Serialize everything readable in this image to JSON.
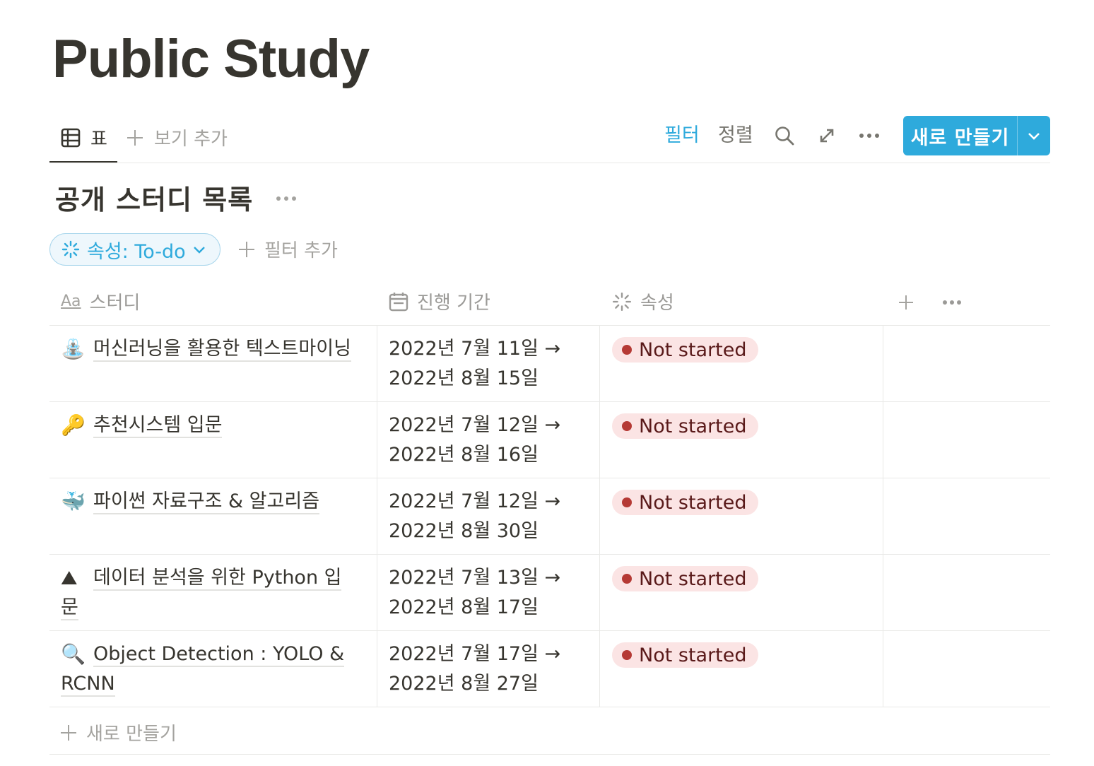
{
  "page": {
    "title": "Public Study"
  },
  "views": {
    "tabs": [
      {
        "label": "표",
        "icon": "table-icon",
        "active": true
      }
    ],
    "add_view_label": "보기 추가"
  },
  "toolbar": {
    "filter_label": "필터",
    "sort_label": "정렬",
    "new_button_label": "새로 만들기",
    "accent_color": "#2eaadc"
  },
  "database": {
    "title": "공개 스터디 목록",
    "filter_chip": {
      "label": "속성: To-do"
    },
    "add_filter_label": "필터 추가",
    "columns": [
      {
        "label": "스터디",
        "icon": "text-icon",
        "icon_text": "Aa"
      },
      {
        "label": "진행 기간",
        "icon": "calendar-icon"
      },
      {
        "label": "속성",
        "icon": "status-icon"
      }
    ],
    "rows": [
      {
        "emoji": "⛲",
        "emoji_name": "fountain-icon",
        "name": "머신러닝을 활용한 텍스트마이닝",
        "date_start": "2022년 7월 11일 →",
        "date_end": "2022년 8월 15일",
        "status": "Not started"
      },
      {
        "emoji": "🔑",
        "emoji_name": "key-icon",
        "name": "추천시스템 입문",
        "date_start": "2022년 7월 12일 →",
        "date_end": "2022년 8월 16일",
        "status": "Not started"
      },
      {
        "emoji": "🐳",
        "emoji_name": "whale-icon",
        "name": "파이썬 자료구조 & 알고리즘",
        "date_start": "2022년 7월 12일 →",
        "date_end": "2022년 8월 30일",
        "status": "Not started"
      },
      {
        "emoji": "⛰",
        "emoji_name": "mountain-icon",
        "name": "데이터 분석을 위한 Python 입문",
        "date_start": "2022년 7월 13일 →",
        "date_end": "2022년 8월 17일",
        "status": "Not started"
      },
      {
        "emoji": "🔍",
        "emoji_name": "magnifier-icon",
        "name": "Object Detection : YOLO & RCNN",
        "date_start": "2022년 7월 17일 →",
        "date_end": "2022년 8월 27일",
        "status": "Not started"
      }
    ],
    "new_row_label": "새로 만들기",
    "status_color": "#b53a35",
    "status_bg": "#fbe4e4"
  }
}
